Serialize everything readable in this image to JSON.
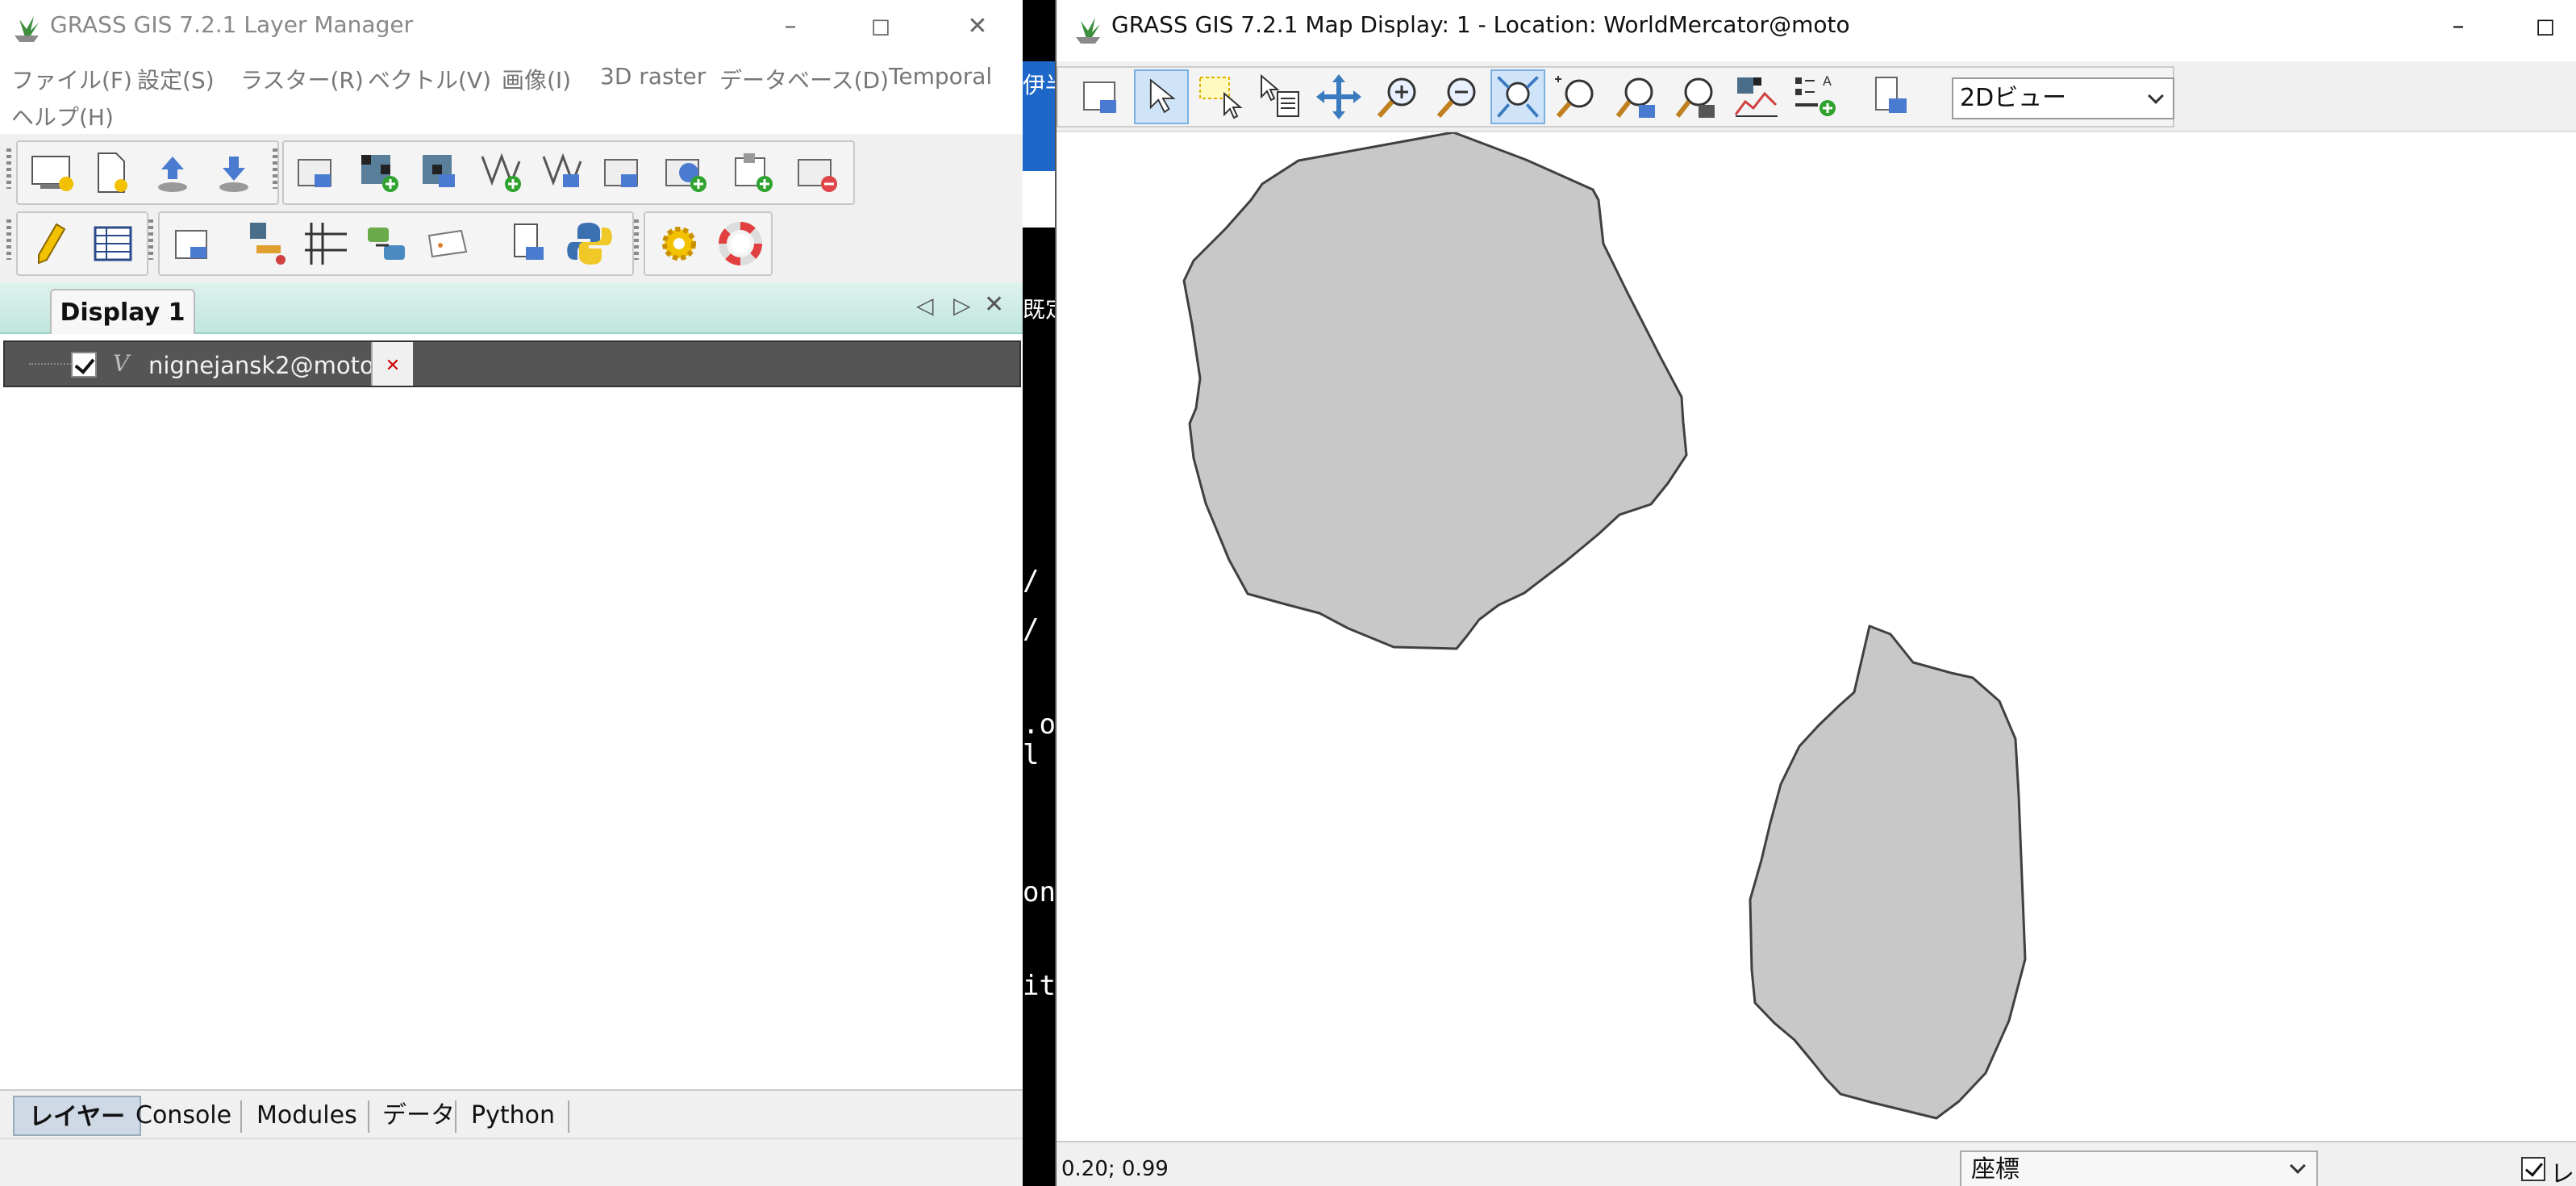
{
  "layer_manager": {
    "title": "GRASS GIS 7.2.1 Layer Manager",
    "menu": [
      "ファイル(F)",
      "設定(S)",
      "ラスター(R)",
      "ベクトル(V)",
      "画像(I)",
      "3D raster",
      "データベース(D)",
      "Temporal",
      "ヘルプ(H)"
    ],
    "display_tab": "Display 1",
    "layer": {
      "name": "nignejansk2@moto",
      "type_icon": "V",
      "checked": true
    },
    "bottom_tabs": [
      "レイヤー",
      "Console",
      "Modules",
      "データ",
      "Python"
    ],
    "icons": {
      "row1": [
        "start-display-icon",
        "new-workspace-icon",
        "open-workspace-icon",
        "save-workspace-icon",
        "add-map-layers-icon",
        "add-raster-icon",
        "add-raster-misc-icon",
        "add-vector-icon",
        "add-vector-misc-icon",
        "add-group-icon",
        "add-overlay-icon",
        "import-icon",
        "remove-layer-icon"
      ],
      "row2": [
        "editor-icon",
        "attribute-table-icon",
        "georectifier-icon",
        "graphical-modeler-icon",
        "cartographic-composer-icon",
        "gcp-manager-icon",
        "map-swipe-icon",
        "python-shell-icon",
        "settings-icon",
        "help-icon"
      ]
    }
  },
  "background_terminal": [
    "伊半",
    "既定",
    "/",
    "/",
    ".o",
    "l",
    "on",
    "it"
  ],
  "map_display": {
    "title": "GRASS GIS 7.2.1 Map Display: 1 - Location: WorldMercator@moto",
    "toolbar_icons": [
      "display-map-icon",
      "pointer-icon",
      "select-icon",
      "query-icon",
      "pan-icon",
      "zoom-in-icon",
      "zoom-out-icon",
      "zoom-extent-icon",
      "zoom-back-icon",
      "zoom-menu-icon",
      "zoom-region-icon",
      "analyze-icon",
      "overlay-icon",
      "save-map-icon"
    ],
    "view_mode": "2Dビュー",
    "coords": "0.20; 0.99",
    "status_mode": "座標",
    "render_label": "レン",
    "render_checked": true,
    "polygon_fill": "#c8c8c8",
    "polygon_stroke": "#404040"
  }
}
